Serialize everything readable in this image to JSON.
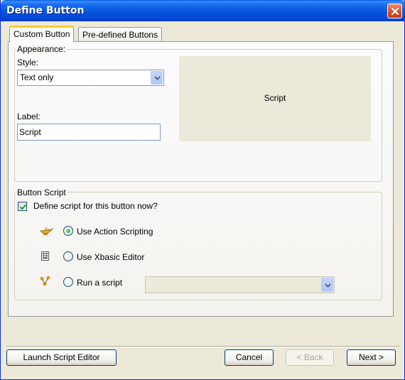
{
  "window": {
    "title": "Define Button"
  },
  "tabs": [
    {
      "label": "Custom Button",
      "active": true
    },
    {
      "label": "Pre-defined Buttons",
      "active": false
    }
  ],
  "appearance": {
    "legend": "Appearance:",
    "style_label": "Style:",
    "style_value": "Text only",
    "label_label": "Label:",
    "label_value": "Script",
    "preview_text": "Script"
  },
  "button_script": {
    "legend": "Button Script",
    "define_now_label": "Define script for this button now?",
    "define_now_checked": true,
    "options": [
      {
        "label": "Use Action Scripting",
        "icon": "genie-lamp-icon",
        "selected": true
      },
      {
        "label": "Use Xbasic Editor",
        "icon": "code-editor-icon",
        "selected": false
      },
      {
        "label": "Run a script",
        "icon": "script-tree-icon",
        "selected": false
      }
    ],
    "run_script_value": ""
  },
  "footer": {
    "launch_editor": "Launch Script Editor",
    "cancel": "Cancel",
    "back": "< Back",
    "next": "Next >"
  },
  "colors": {
    "titlebar": "#0855dd",
    "face": "#ece9d8",
    "tab_highlight": "#ffc83c",
    "check_green": "#21a121"
  }
}
